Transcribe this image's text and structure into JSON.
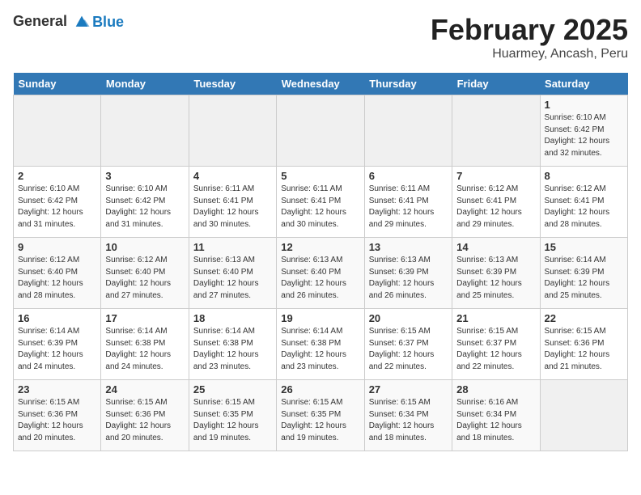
{
  "header": {
    "logo_line1": "General",
    "logo_line2": "Blue",
    "month_year": "February 2025",
    "location": "Huarmey, Ancash, Peru"
  },
  "days_of_week": [
    "Sunday",
    "Monday",
    "Tuesday",
    "Wednesday",
    "Thursday",
    "Friday",
    "Saturday"
  ],
  "weeks": [
    [
      {
        "num": "",
        "info": ""
      },
      {
        "num": "",
        "info": ""
      },
      {
        "num": "",
        "info": ""
      },
      {
        "num": "",
        "info": ""
      },
      {
        "num": "",
        "info": ""
      },
      {
        "num": "",
        "info": ""
      },
      {
        "num": "1",
        "info": "Sunrise: 6:10 AM\nSunset: 6:42 PM\nDaylight: 12 hours and 32 minutes."
      }
    ],
    [
      {
        "num": "2",
        "info": "Sunrise: 6:10 AM\nSunset: 6:42 PM\nDaylight: 12 hours and 31 minutes."
      },
      {
        "num": "3",
        "info": "Sunrise: 6:10 AM\nSunset: 6:42 PM\nDaylight: 12 hours and 31 minutes."
      },
      {
        "num": "4",
        "info": "Sunrise: 6:11 AM\nSunset: 6:41 PM\nDaylight: 12 hours and 30 minutes."
      },
      {
        "num": "5",
        "info": "Sunrise: 6:11 AM\nSunset: 6:41 PM\nDaylight: 12 hours and 30 minutes."
      },
      {
        "num": "6",
        "info": "Sunrise: 6:11 AM\nSunset: 6:41 PM\nDaylight: 12 hours and 29 minutes."
      },
      {
        "num": "7",
        "info": "Sunrise: 6:12 AM\nSunset: 6:41 PM\nDaylight: 12 hours and 29 minutes."
      },
      {
        "num": "8",
        "info": "Sunrise: 6:12 AM\nSunset: 6:41 PM\nDaylight: 12 hours and 28 minutes."
      }
    ],
    [
      {
        "num": "9",
        "info": "Sunrise: 6:12 AM\nSunset: 6:40 PM\nDaylight: 12 hours and 28 minutes."
      },
      {
        "num": "10",
        "info": "Sunrise: 6:12 AM\nSunset: 6:40 PM\nDaylight: 12 hours and 27 minutes."
      },
      {
        "num": "11",
        "info": "Sunrise: 6:13 AM\nSunset: 6:40 PM\nDaylight: 12 hours and 27 minutes."
      },
      {
        "num": "12",
        "info": "Sunrise: 6:13 AM\nSunset: 6:40 PM\nDaylight: 12 hours and 26 minutes."
      },
      {
        "num": "13",
        "info": "Sunrise: 6:13 AM\nSunset: 6:39 PM\nDaylight: 12 hours and 26 minutes."
      },
      {
        "num": "14",
        "info": "Sunrise: 6:13 AM\nSunset: 6:39 PM\nDaylight: 12 hours and 25 minutes."
      },
      {
        "num": "15",
        "info": "Sunrise: 6:14 AM\nSunset: 6:39 PM\nDaylight: 12 hours and 25 minutes."
      }
    ],
    [
      {
        "num": "16",
        "info": "Sunrise: 6:14 AM\nSunset: 6:39 PM\nDaylight: 12 hours and 24 minutes."
      },
      {
        "num": "17",
        "info": "Sunrise: 6:14 AM\nSunset: 6:38 PM\nDaylight: 12 hours and 24 minutes."
      },
      {
        "num": "18",
        "info": "Sunrise: 6:14 AM\nSunset: 6:38 PM\nDaylight: 12 hours and 23 minutes."
      },
      {
        "num": "19",
        "info": "Sunrise: 6:14 AM\nSunset: 6:38 PM\nDaylight: 12 hours and 23 minutes."
      },
      {
        "num": "20",
        "info": "Sunrise: 6:15 AM\nSunset: 6:37 PM\nDaylight: 12 hours and 22 minutes."
      },
      {
        "num": "21",
        "info": "Sunrise: 6:15 AM\nSunset: 6:37 PM\nDaylight: 12 hours and 22 minutes."
      },
      {
        "num": "22",
        "info": "Sunrise: 6:15 AM\nSunset: 6:36 PM\nDaylight: 12 hours and 21 minutes."
      }
    ],
    [
      {
        "num": "23",
        "info": "Sunrise: 6:15 AM\nSunset: 6:36 PM\nDaylight: 12 hours and 20 minutes."
      },
      {
        "num": "24",
        "info": "Sunrise: 6:15 AM\nSunset: 6:36 PM\nDaylight: 12 hours and 20 minutes."
      },
      {
        "num": "25",
        "info": "Sunrise: 6:15 AM\nSunset: 6:35 PM\nDaylight: 12 hours and 19 minutes."
      },
      {
        "num": "26",
        "info": "Sunrise: 6:15 AM\nSunset: 6:35 PM\nDaylight: 12 hours and 19 minutes."
      },
      {
        "num": "27",
        "info": "Sunrise: 6:15 AM\nSunset: 6:34 PM\nDaylight: 12 hours and 18 minutes."
      },
      {
        "num": "28",
        "info": "Sunrise: 6:16 AM\nSunset: 6:34 PM\nDaylight: 12 hours and 18 minutes."
      },
      {
        "num": "",
        "info": ""
      }
    ]
  ]
}
